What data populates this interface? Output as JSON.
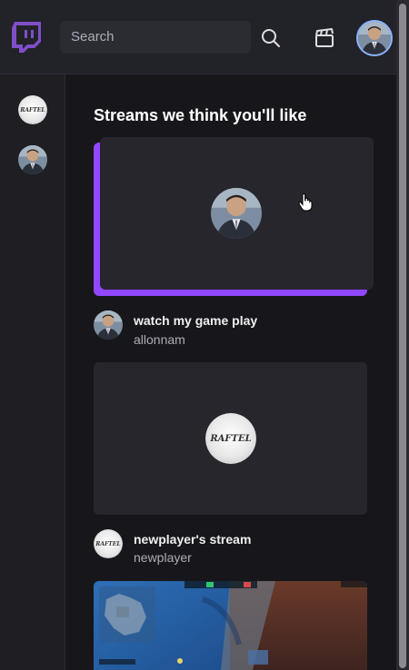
{
  "header": {
    "search_placeholder": "Search"
  },
  "sidebar": {
    "channels": [
      {
        "name": "newplayer",
        "avatar": "raftel-logo"
      },
      {
        "name": "allonnam",
        "avatar": "person-photo"
      }
    ]
  },
  "main": {
    "section_title": "Streams we think you'll like",
    "streams": [
      {
        "title": "watch my game play",
        "user": "allonnam",
        "thumbnail": "avatar-placeholder"
      },
      {
        "title": "newplayer's stream",
        "user": "newplayer",
        "thumbnail": "avatar-placeholder"
      },
      {
        "title": "",
        "user": "",
        "thumbnail": "game-screenshot"
      }
    ]
  },
  "logo_text": "RAFTEL",
  "colors": {
    "accent": "#9147ff",
    "header_bg": "#222229",
    "sidebar_bg": "#1f1f23",
    "page_bg": "#17171b",
    "card_bg": "#26262c"
  }
}
